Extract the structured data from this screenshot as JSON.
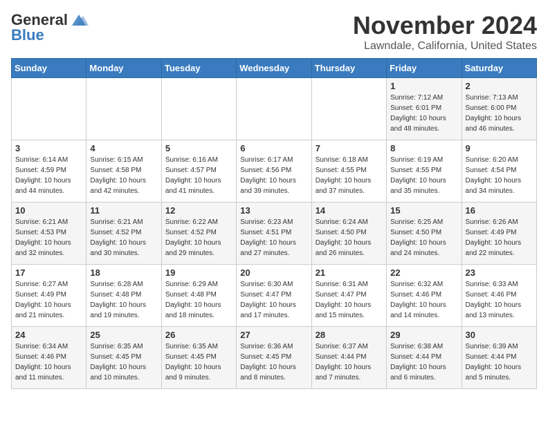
{
  "header": {
    "logo_general": "General",
    "logo_blue": "Blue",
    "month": "November 2024",
    "location": "Lawndale, California, United States"
  },
  "weekdays": [
    "Sunday",
    "Monday",
    "Tuesday",
    "Wednesday",
    "Thursday",
    "Friday",
    "Saturday"
  ],
  "weeks": [
    [
      {
        "day": "",
        "info": ""
      },
      {
        "day": "",
        "info": ""
      },
      {
        "day": "",
        "info": ""
      },
      {
        "day": "",
        "info": ""
      },
      {
        "day": "",
        "info": ""
      },
      {
        "day": "1",
        "info": "Sunrise: 7:12 AM\nSunset: 6:01 PM\nDaylight: 10 hours\nand 48 minutes."
      },
      {
        "day": "2",
        "info": "Sunrise: 7:13 AM\nSunset: 6:00 PM\nDaylight: 10 hours\nand 46 minutes."
      }
    ],
    [
      {
        "day": "3",
        "info": "Sunrise: 6:14 AM\nSunset: 4:59 PM\nDaylight: 10 hours\nand 44 minutes."
      },
      {
        "day": "4",
        "info": "Sunrise: 6:15 AM\nSunset: 4:58 PM\nDaylight: 10 hours\nand 42 minutes."
      },
      {
        "day": "5",
        "info": "Sunrise: 6:16 AM\nSunset: 4:57 PM\nDaylight: 10 hours\nand 41 minutes."
      },
      {
        "day": "6",
        "info": "Sunrise: 6:17 AM\nSunset: 4:56 PM\nDaylight: 10 hours\nand 39 minutes."
      },
      {
        "day": "7",
        "info": "Sunrise: 6:18 AM\nSunset: 4:55 PM\nDaylight: 10 hours\nand 37 minutes."
      },
      {
        "day": "8",
        "info": "Sunrise: 6:19 AM\nSunset: 4:55 PM\nDaylight: 10 hours\nand 35 minutes."
      },
      {
        "day": "9",
        "info": "Sunrise: 6:20 AM\nSunset: 4:54 PM\nDaylight: 10 hours\nand 34 minutes."
      }
    ],
    [
      {
        "day": "10",
        "info": "Sunrise: 6:21 AM\nSunset: 4:53 PM\nDaylight: 10 hours\nand 32 minutes."
      },
      {
        "day": "11",
        "info": "Sunrise: 6:21 AM\nSunset: 4:52 PM\nDaylight: 10 hours\nand 30 minutes."
      },
      {
        "day": "12",
        "info": "Sunrise: 6:22 AM\nSunset: 4:52 PM\nDaylight: 10 hours\nand 29 minutes."
      },
      {
        "day": "13",
        "info": "Sunrise: 6:23 AM\nSunset: 4:51 PM\nDaylight: 10 hours\nand 27 minutes."
      },
      {
        "day": "14",
        "info": "Sunrise: 6:24 AM\nSunset: 4:50 PM\nDaylight: 10 hours\nand 26 minutes."
      },
      {
        "day": "15",
        "info": "Sunrise: 6:25 AM\nSunset: 4:50 PM\nDaylight: 10 hours\nand 24 minutes."
      },
      {
        "day": "16",
        "info": "Sunrise: 6:26 AM\nSunset: 4:49 PM\nDaylight: 10 hours\nand 22 minutes."
      }
    ],
    [
      {
        "day": "17",
        "info": "Sunrise: 6:27 AM\nSunset: 4:49 PM\nDaylight: 10 hours\nand 21 minutes."
      },
      {
        "day": "18",
        "info": "Sunrise: 6:28 AM\nSunset: 4:48 PM\nDaylight: 10 hours\nand 19 minutes."
      },
      {
        "day": "19",
        "info": "Sunrise: 6:29 AM\nSunset: 4:48 PM\nDaylight: 10 hours\nand 18 minutes."
      },
      {
        "day": "20",
        "info": "Sunrise: 6:30 AM\nSunset: 4:47 PM\nDaylight: 10 hours\nand 17 minutes."
      },
      {
        "day": "21",
        "info": "Sunrise: 6:31 AM\nSunset: 4:47 PM\nDaylight: 10 hours\nand 15 minutes."
      },
      {
        "day": "22",
        "info": "Sunrise: 6:32 AM\nSunset: 4:46 PM\nDaylight: 10 hours\nand 14 minutes."
      },
      {
        "day": "23",
        "info": "Sunrise: 6:33 AM\nSunset: 4:46 PM\nDaylight: 10 hours\nand 13 minutes."
      }
    ],
    [
      {
        "day": "24",
        "info": "Sunrise: 6:34 AM\nSunset: 4:46 PM\nDaylight: 10 hours\nand 11 minutes."
      },
      {
        "day": "25",
        "info": "Sunrise: 6:35 AM\nSunset: 4:45 PM\nDaylight: 10 hours\nand 10 minutes."
      },
      {
        "day": "26",
        "info": "Sunrise: 6:35 AM\nSunset: 4:45 PM\nDaylight: 10 hours\nand 9 minutes."
      },
      {
        "day": "27",
        "info": "Sunrise: 6:36 AM\nSunset: 4:45 PM\nDaylight: 10 hours\nand 8 minutes."
      },
      {
        "day": "28",
        "info": "Sunrise: 6:37 AM\nSunset: 4:44 PM\nDaylight: 10 hours\nand 7 minutes."
      },
      {
        "day": "29",
        "info": "Sunrise: 6:38 AM\nSunset: 4:44 PM\nDaylight: 10 hours\nand 6 minutes."
      },
      {
        "day": "30",
        "info": "Sunrise: 6:39 AM\nSunset: 4:44 PM\nDaylight: 10 hours\nand 5 minutes."
      }
    ]
  ]
}
